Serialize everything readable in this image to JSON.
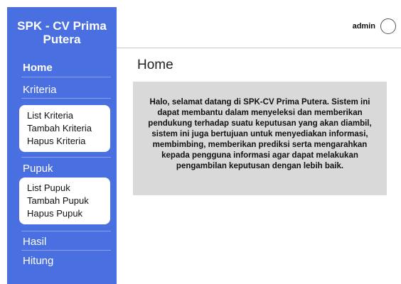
{
  "brand": {
    "line1": "SPK - CV Prima",
    "line2": "Putera"
  },
  "nav": {
    "home": "Home",
    "kriteria": "Kriteria",
    "kriteria_items": [
      "List Kriteria",
      "Tambah Kriteria",
      "Hapus Kriteria"
    ],
    "pupuk": "Pupuk",
    "pupuk_items": [
      "List Pupuk",
      "Tambah Pupuk",
      "Hapus Pupuk"
    ],
    "hasil": "Hasil",
    "hitung": "Hitung"
  },
  "header": {
    "username": "admin",
    "avatar_icon": "user-avatar-icon"
  },
  "main": {
    "title": "Home",
    "welcome_text": "Halo, selamat datang di SPK-CV Prima Putera. Sistem ini dapat membantu dalam menyeleksi dan memberikan pendukung terhadap suatu keputusan yang akan diambil, sistem ini juga bertujuan untuk menyediakan informasi, membimbing, memberikan prediksi serta mengarahkan kepada pengguna informasi agar dapat melakukan pengambilan keputusan dengan lebih baik."
  },
  "colors": {
    "sidebar": "#4a6fe0",
    "welcome_bg": "#d9d9d9"
  }
}
